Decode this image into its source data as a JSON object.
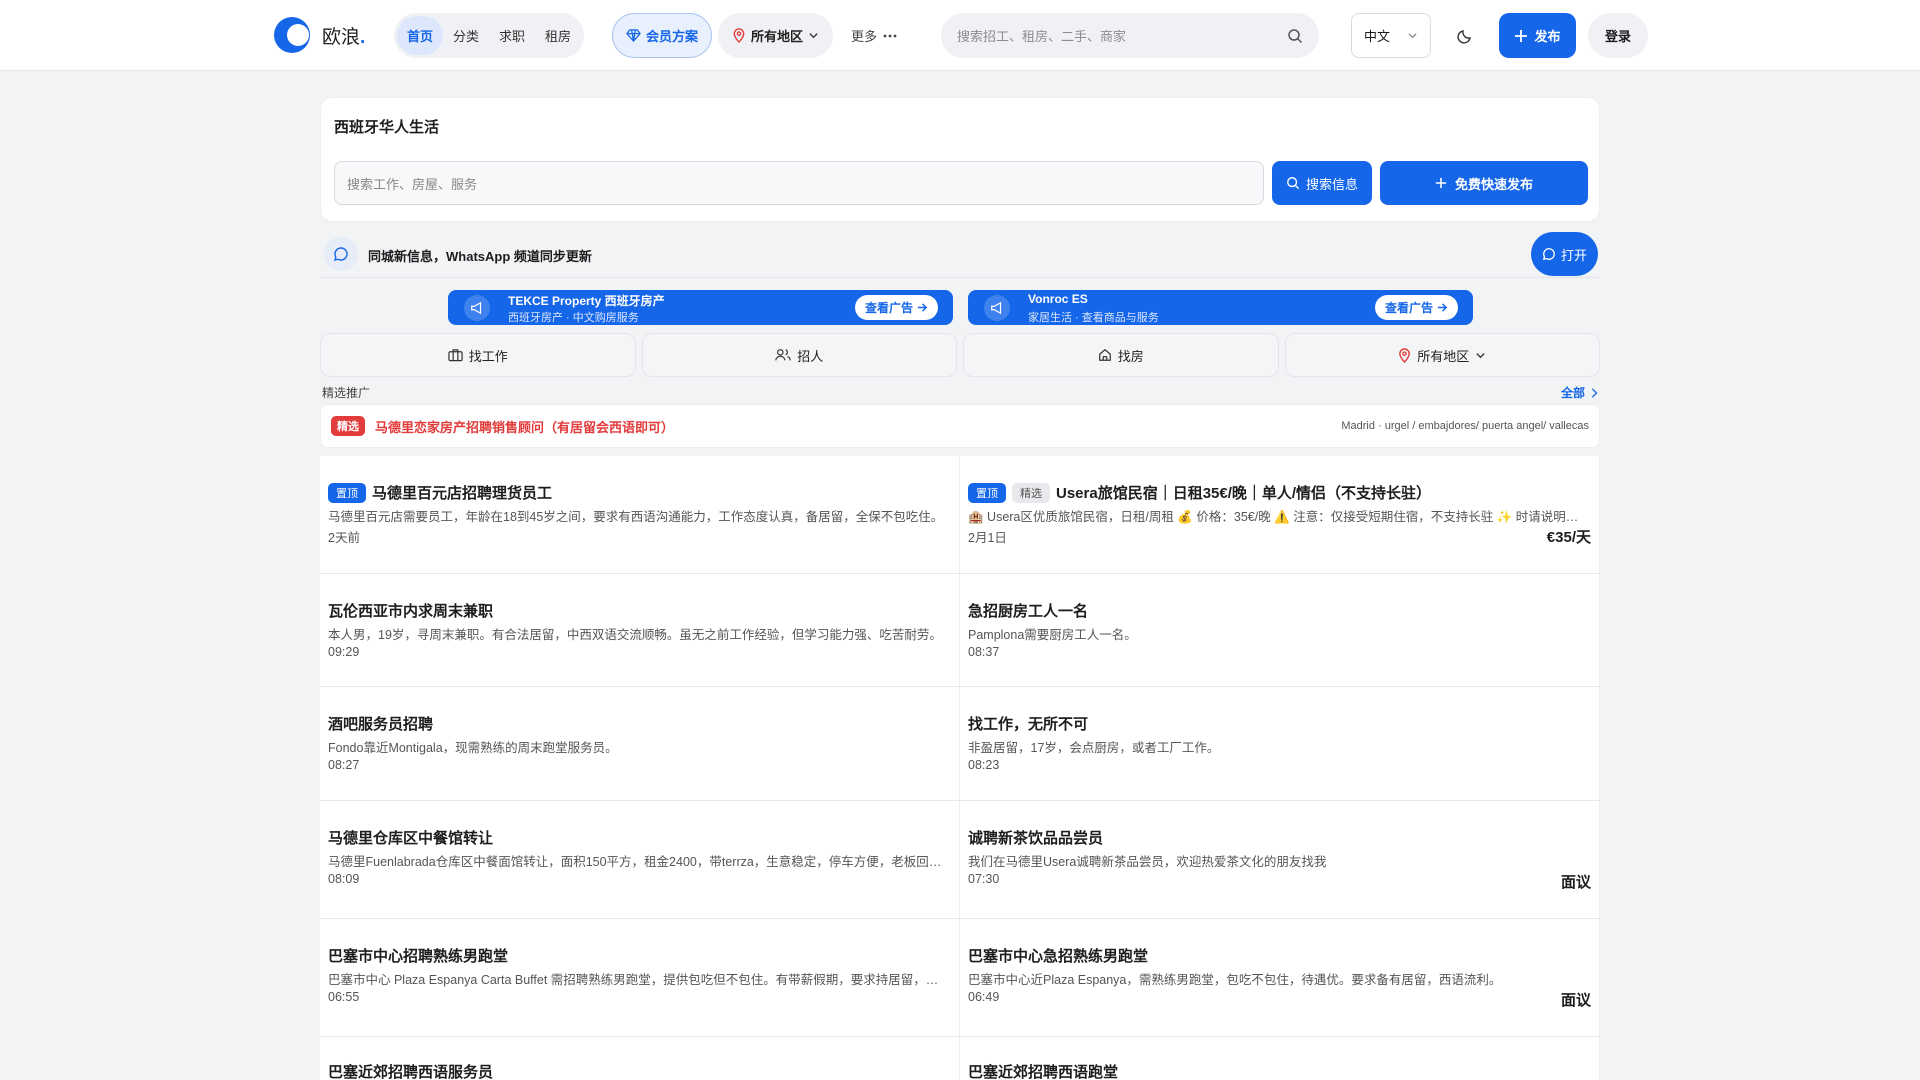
{
  "header": {
    "logo_text": "欧浪",
    "logo_dot": ".",
    "nav": [
      "首页",
      "分类",
      "求职",
      "租房"
    ],
    "vip_label": "会员方案",
    "region_label": "所有地区",
    "more_label": "更多",
    "search_placeholder": "搜索招工、租房、二手、商家",
    "lang_label": "中文",
    "publish_label": "发布",
    "login_label": "登录"
  },
  "hero": {
    "title": "西班牙华人生活",
    "search_placeholder": "搜索工作、房屋、服务",
    "search_btn": "搜索信息",
    "post_btn": "免费快速发布"
  },
  "whatsapp": {
    "text": "同城新信息，WhatsApp 频道同步更新",
    "open_btn": "打开"
  },
  "ads": [
    {
      "title": "TEKCE Property 西班牙房产",
      "sub": "西班牙房产 · 中文购房服务",
      "btn": "查看广告"
    },
    {
      "title": "Vonroc ES",
      "sub": "家居生活 · 查看商品与服务",
      "btn": "查看广告"
    }
  ],
  "tabs": [
    "找工作",
    "招人",
    "找房",
    "所有地区"
  ],
  "featured": {
    "label": "精选推广",
    "all": "全部",
    "tag": "精选",
    "title": "马德里恋家房产招聘销售顾问（有居留会西语即可）",
    "location": "Madrid · urgel / embajdores/ puerta angel/ vallecas"
  },
  "listings": [
    {
      "badges": [
        "置顶"
      ],
      "title": "马德里百元店招聘理货员工",
      "desc": "马德里百元店需要员工，年龄在18到45岁之间，要求有西语沟通能力，工作态度认真，备居留，全保不包吃住。",
      "time": "2天前",
      "price": ""
    },
    {
      "badges": [
        "置顶",
        "精选"
      ],
      "title": "Usera旅馆民宿｜日租35€/晚｜单人/情侣（不支持长驻）",
      "desc": "🏨 Usera区优质旅馆民宿，日租/周租 💰 价格：35€/晚 ⚠️ 注意：仅接受短期住宿，不支持长驻 ✨ 时请说明入住日期。",
      "time": "2月1日",
      "price": "€35/天"
    },
    {
      "badges": [],
      "title": "瓦伦西亚市内求周末兼职",
      "desc": "本人男，19岁，寻周末兼职。有合法居留，中西双语交流顺畅。虽无之前工作经验，但学习能力强、吃苦耐劳。",
      "time": "09:29",
      "price": ""
    },
    {
      "badges": [],
      "title": "急招厨房工人一名",
      "desc": "Pamplona需要厨房工人一名。",
      "time": "08:37",
      "price": ""
    },
    {
      "badges": [],
      "title": "酒吧服务员招聘",
      "desc": "Fondo靠近Montigala，现需熟练的周末跑堂服务员。",
      "time": "08:27",
      "price": ""
    },
    {
      "badges": [],
      "title": "找工作，无所不可",
      "desc": "非盈居留，17岁，会点厨房，或者工厂工作。",
      "time": "08:23",
      "price": ""
    },
    {
      "badges": [],
      "title": "马德里仓库区中餐馆转让",
      "desc": "马德里Fuenlabrada仓库区中餐面馆转让，面积150平方，租金2400，带terrza，生意稳定，停车方便，老板回国。",
      "time": "08:09",
      "price": ""
    },
    {
      "badges": [],
      "title": "诚聘新茶饮品品尝员",
      "desc": "我们在马德里Usera诚聘新茶品尝员，欢迎热爱茶文化的朋友找我",
      "time": "07:30",
      "price": "面议"
    },
    {
      "badges": [],
      "title": "巴塞市中心招聘熟练男跑堂",
      "desc": "巴塞市中心 Plaza Espanya Carta Buffet 需招聘熟练男跑堂，提供包吃但不包住。有带薪假期，要求持居留，西语流利。",
      "time": "06:55",
      "price": ""
    },
    {
      "badges": [],
      "title": "巴塞市中心急招熟练男跑堂",
      "desc": "巴塞市中心近Plaza Espanya，需熟练男跑堂，包吃不包住，待遇优。要求备有居留，西语流利。",
      "time": "06:49",
      "price": "面议"
    },
    {
      "badges": [],
      "title": "巴塞近郊招聘西语服务员",
      "desc": "",
      "time": "",
      "price": ""
    },
    {
      "badges": [],
      "title": "巴塞近郊招聘西语跑堂",
      "desc": "",
      "time": "",
      "price": ""
    }
  ],
  "colors": {
    "primary": "#1566e8",
    "featured_red": "#e23b3b",
    "background": "#f2f3f5"
  }
}
